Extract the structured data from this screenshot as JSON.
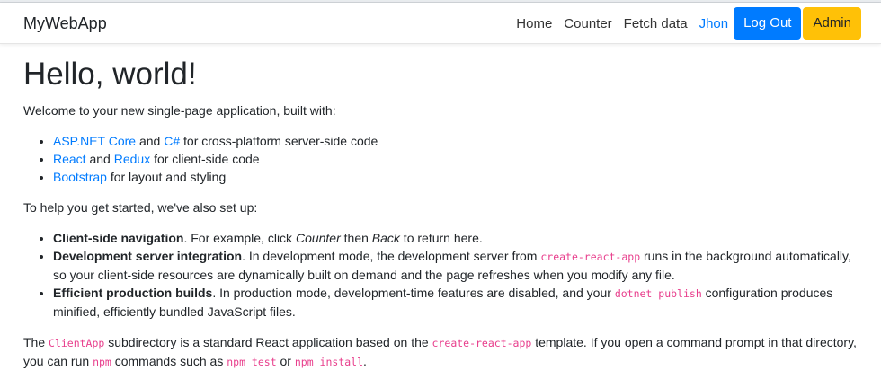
{
  "nav": {
    "brand": "MyWebApp",
    "links": [
      "Home",
      "Counter",
      "Fetch data"
    ],
    "user": "Jhon",
    "logout": "Log Out",
    "admin": "Admin"
  },
  "main": {
    "title": "Hello, world!",
    "intro": "Welcome to your new single-page application, built with:",
    "built_with": [
      {
        "link1": "ASP.NET Core",
        "mid": " and ",
        "link2": "C#",
        "tail": " for cross-platform server-side code"
      },
      {
        "link1": "React",
        "mid": " and ",
        "link2": "Redux",
        "tail": " for client-side code"
      },
      {
        "link1": "Bootstrap",
        "tail": " for layout and styling"
      }
    ],
    "setup_intro": "To help you get started, we've also set up:",
    "setup": {
      "nav_title": "Client-side navigation",
      "nav_text1": ". For example, click ",
      "nav_em1": "Counter",
      "nav_text2": " then ",
      "nav_em2": "Back",
      "nav_text3": " to return here.",
      "dev_title": "Development server integration",
      "dev_text1": ". In development mode, the development server from ",
      "dev_code": "create-react-app",
      "dev_text2": " runs in the background automatically, so your client-side resources are dynamically built on demand and the page refreshes when you modify any file.",
      "prod_title": "Efficient production builds",
      "prod_text1": ". In production mode, development-time features are disabled, and your ",
      "prod_code": "dotnet publish",
      "prod_text2": " configuration produces minified, efficiently bundled JavaScript files."
    },
    "footer": {
      "t1": "The ",
      "c1": "ClientApp",
      "t2": " subdirectory is a standard React application based on the ",
      "c2": "create-react-app",
      "t3": " template. If you open a command prompt in that directory, you can run ",
      "c3": "npm",
      "t4": " commands such as ",
      "c4": "npm test",
      "t5": " or ",
      "c5": "npm install",
      "t6": "."
    }
  },
  "colors": {
    "link": "#007bff",
    "primary": "#007bff",
    "warning": "#ffc107",
    "code": "#e83e8c"
  }
}
